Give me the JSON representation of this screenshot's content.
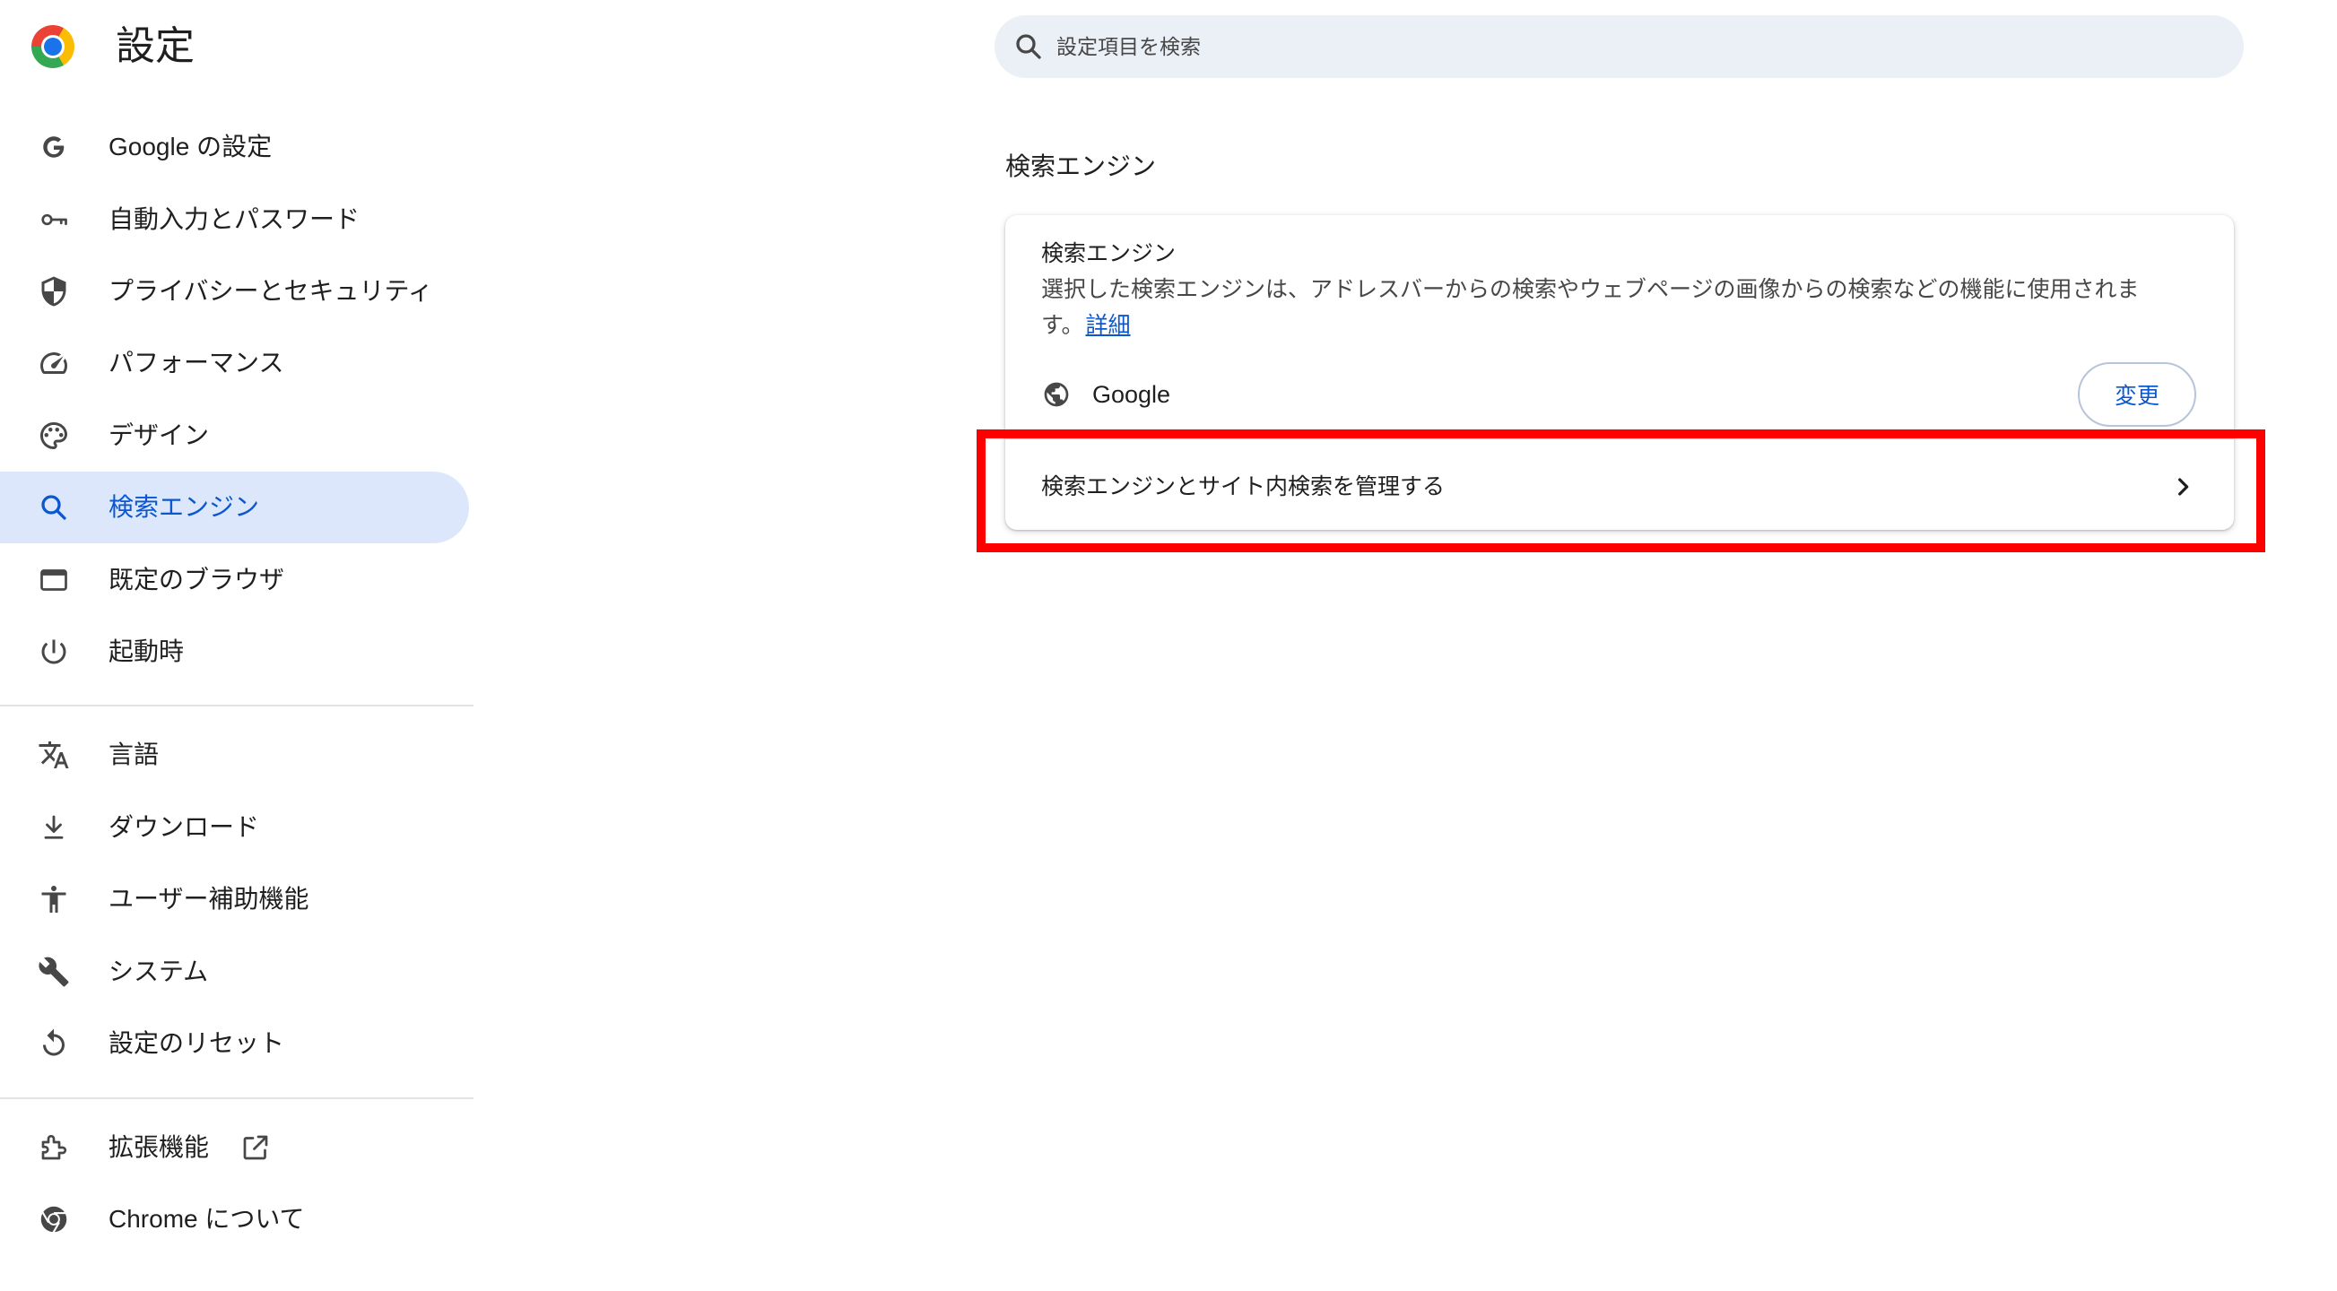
{
  "header": {
    "title": "設定",
    "logo_icon": "chrome-logo-icon"
  },
  "search": {
    "placeholder": "設定項目を検索",
    "icon": "search-icon"
  },
  "sidebar": {
    "items": [
      {
        "label": "Google の設定",
        "icon": "google-g-icon"
      },
      {
        "label": "自動入力とパスワード",
        "icon": "key-icon"
      },
      {
        "label": "プライバシーとセキュリティ",
        "icon": "shield-icon"
      },
      {
        "label": "パフォーマンス",
        "icon": "speedometer-icon"
      },
      {
        "label": "デザイン",
        "icon": "palette-icon"
      },
      {
        "label": "検索エンジン",
        "icon": "search-icon",
        "selected": true
      },
      {
        "label": "既定のブラウザ",
        "icon": "browser-window-icon"
      },
      {
        "label": "起動時",
        "icon": "power-icon"
      },
      {
        "label": "言語",
        "icon": "translate-icon"
      },
      {
        "label": "ダウンロード",
        "icon": "download-icon"
      },
      {
        "label": "ユーザー補助機能",
        "icon": "accessibility-icon"
      },
      {
        "label": "システム",
        "icon": "wrench-icon"
      },
      {
        "label": "設定のリセット",
        "icon": "reset-icon"
      },
      {
        "label": "拡張機能",
        "icon": "puzzle-icon",
        "trailing_icon": "external-link-icon"
      },
      {
        "label": "Chrome について",
        "icon": "chrome-icon"
      }
    ]
  },
  "main": {
    "section_title": "検索エンジン",
    "card": {
      "title": "検索エンジン",
      "description": "選択した検索エンジンは、アドレスバーからの検索やウェブページの画像からの検索などの機能に使用されます。",
      "learn_more": "詳細",
      "current_engine": {
        "name": "Google",
        "icon": "globe-icon"
      },
      "change_button": "変更",
      "manage_row": {
        "label": "検索エンジンとサイト内検索を管理する",
        "icon": "chevron-right-icon"
      }
    }
  },
  "colors": {
    "text": "#1f1f1f",
    "text_secondary": "#474747",
    "accent": "#0b57d0",
    "active_bg": "#dde7fb",
    "search_bg": "#ebeff6",
    "divider": "#e3e3e3",
    "button_border": "#b6c4dc",
    "highlight_box": "#ff0000",
    "chrome_red": "#ea4335",
    "chrome_yellow": "#fbbc04",
    "chrome_green": "#34a853",
    "chrome_blue": "#1a73e8"
  }
}
